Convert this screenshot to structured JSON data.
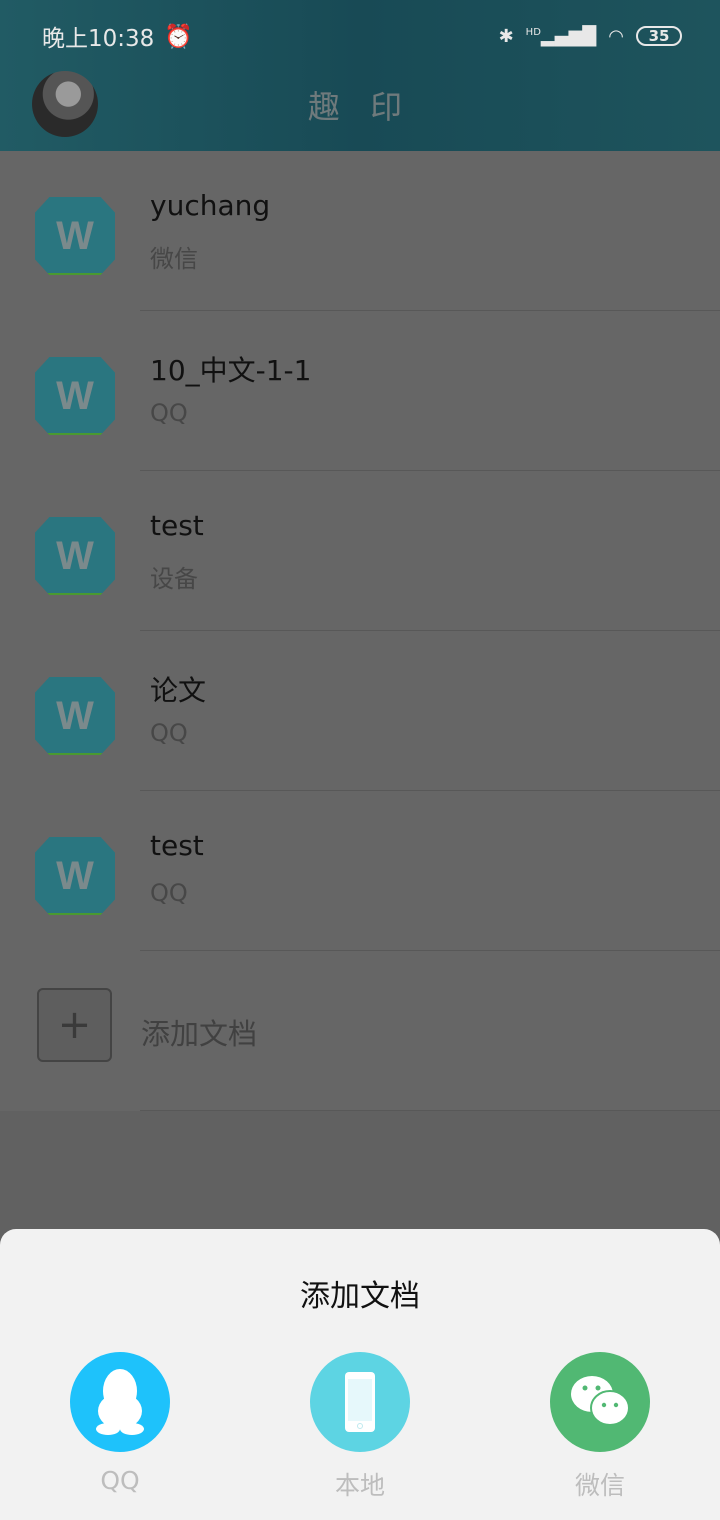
{
  "status": {
    "time": "晚上10:38",
    "battery": "35",
    "network": "HD"
  },
  "header": {
    "title": "趣 印"
  },
  "documents": [
    {
      "name": "yuchang",
      "source": "微信",
      "icon_letter": "W"
    },
    {
      "name": "10_中文-1-1",
      "source": "QQ",
      "icon_letter": "W"
    },
    {
      "name": "test",
      "source": "设备",
      "icon_letter": "W"
    },
    {
      "name": "论文",
      "source": "QQ",
      "icon_letter": "W"
    },
    {
      "name": "test",
      "source": "QQ",
      "icon_letter": "W"
    }
  ],
  "add": {
    "label": "添加文档"
  },
  "sheet": {
    "title": "添加文档",
    "options": [
      {
        "label": "QQ",
        "color": "#1ec2fb"
      },
      {
        "label": "本地",
        "color": "#5dd4e3"
      },
      {
        "label": "微信",
        "color": "#51b873"
      }
    ]
  }
}
